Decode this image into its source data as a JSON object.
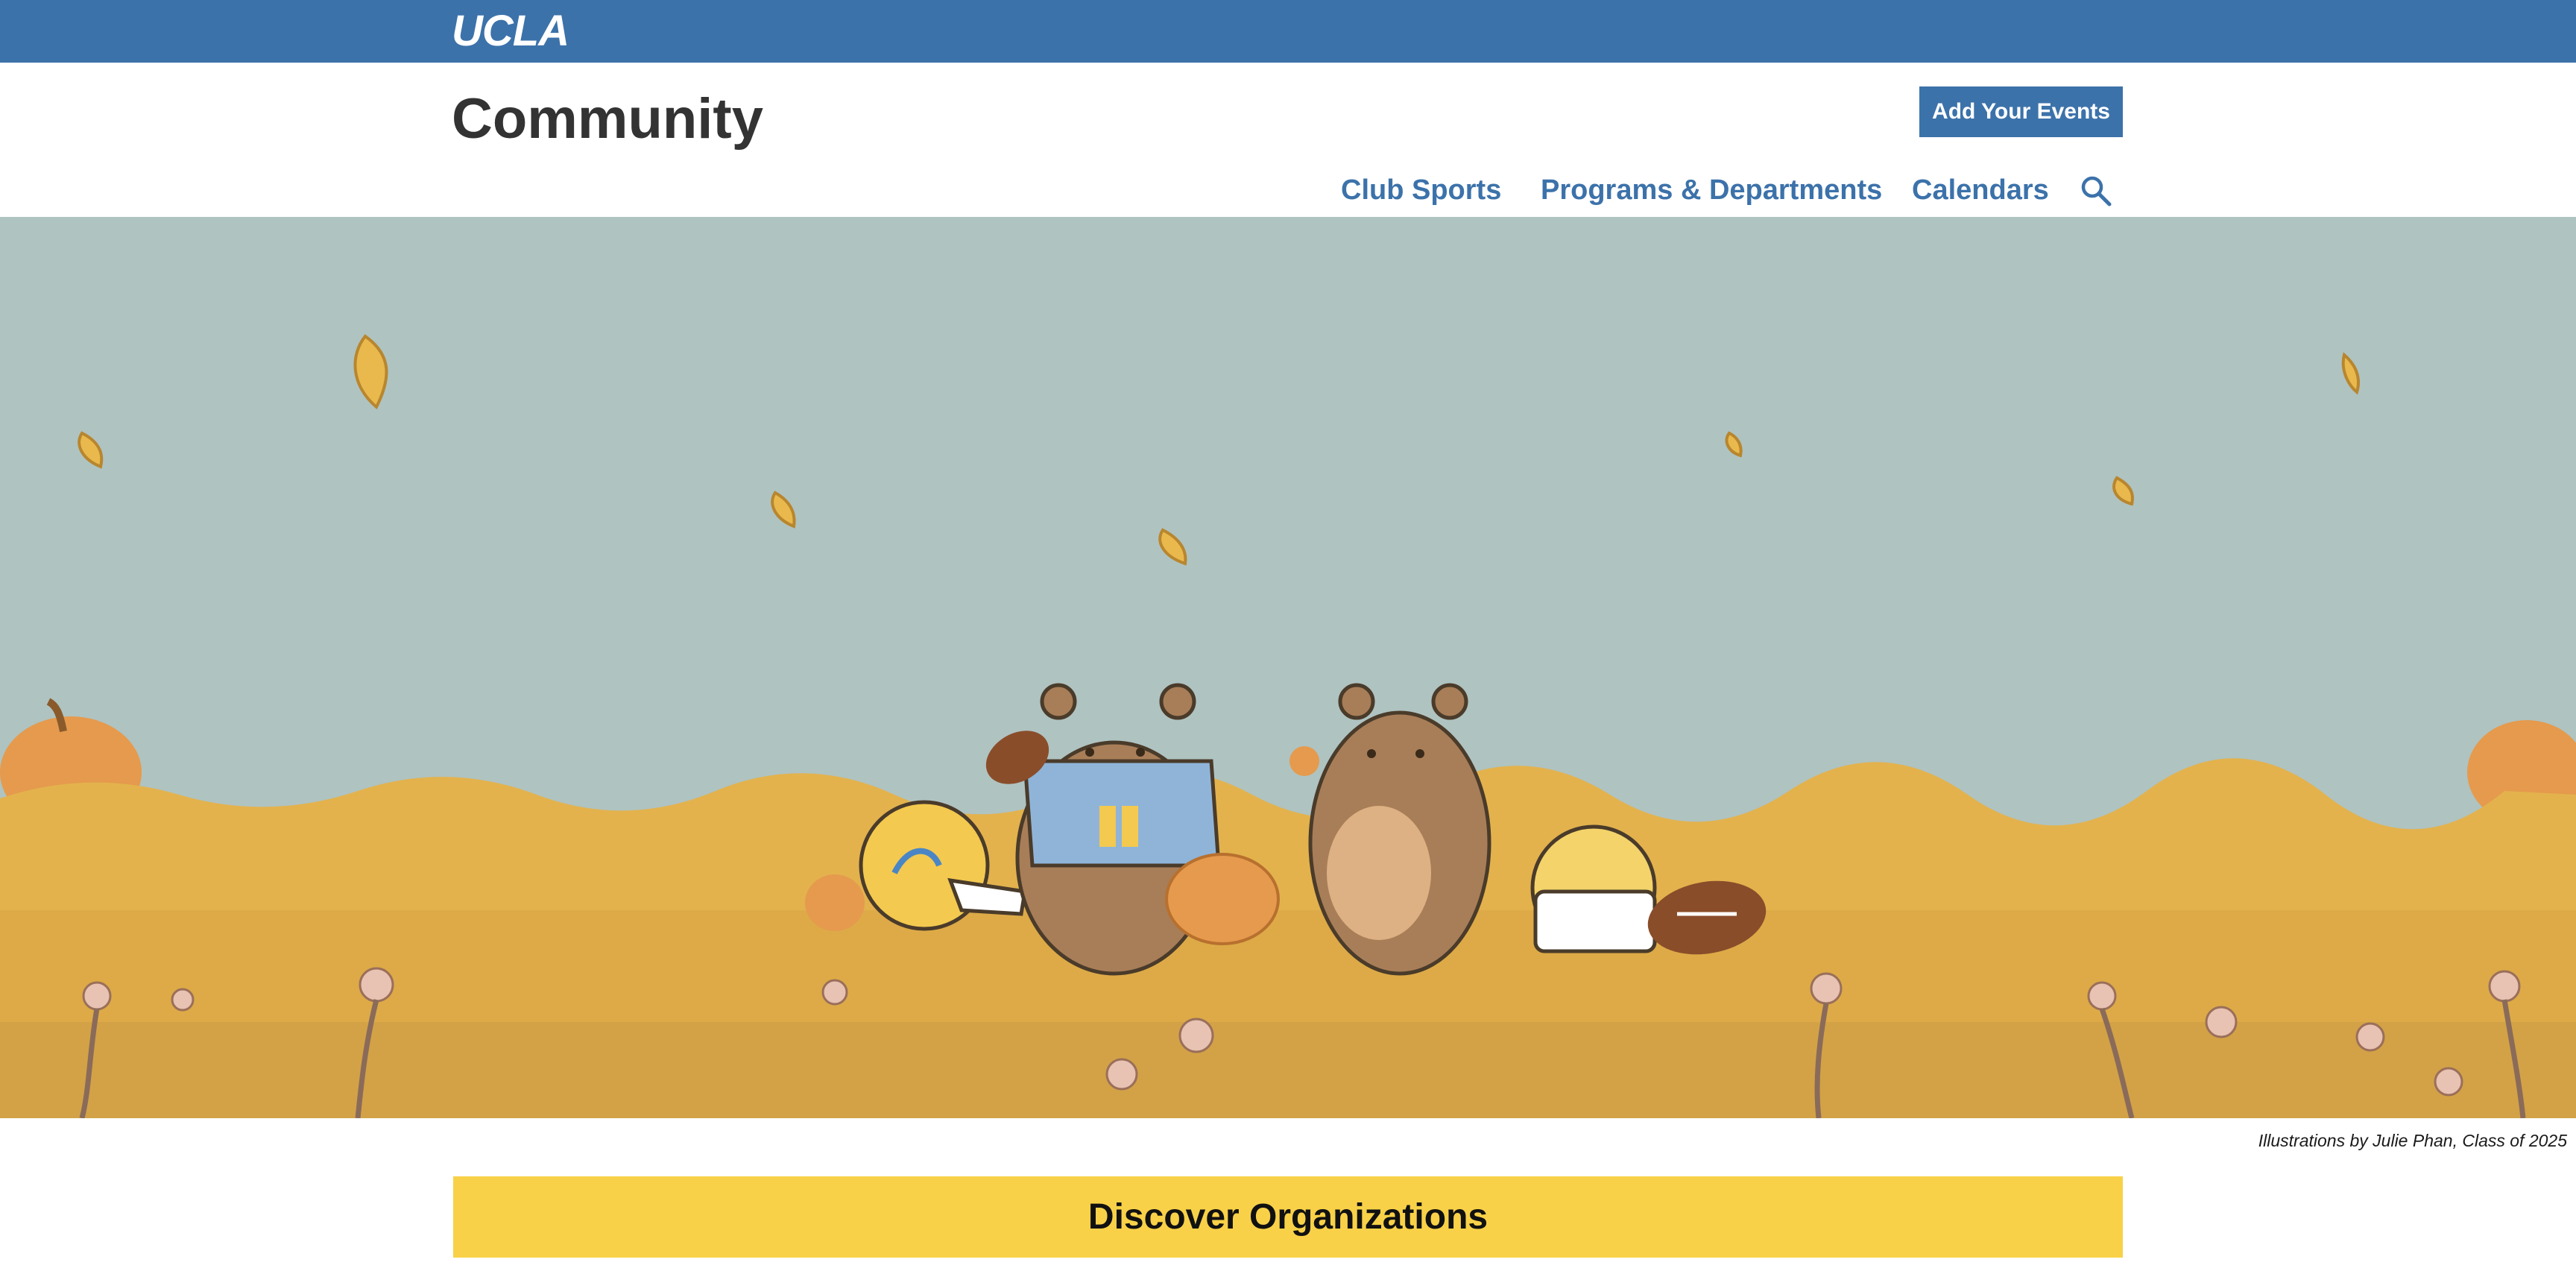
{
  "brand": {
    "logo_text": "UCLA",
    "primary_color": "#3c72aa"
  },
  "header": {
    "title": "Community",
    "add_events_label": "Add Your Events"
  },
  "nav": {
    "items": [
      {
        "label": "Club Sports"
      },
      {
        "label": "Programs & Departments"
      },
      {
        "label": "Calendars"
      }
    ],
    "search_icon": "search-icon"
  },
  "hero": {
    "illustration": "autumn-field-with-bears",
    "sky_color": "#afc3c1",
    "field_color": "#e3b24d"
  },
  "credit": "Illustrations by Julie Phan, Class of 2025",
  "discover": {
    "label": "Discover Organizations",
    "color": "#f8d148"
  }
}
